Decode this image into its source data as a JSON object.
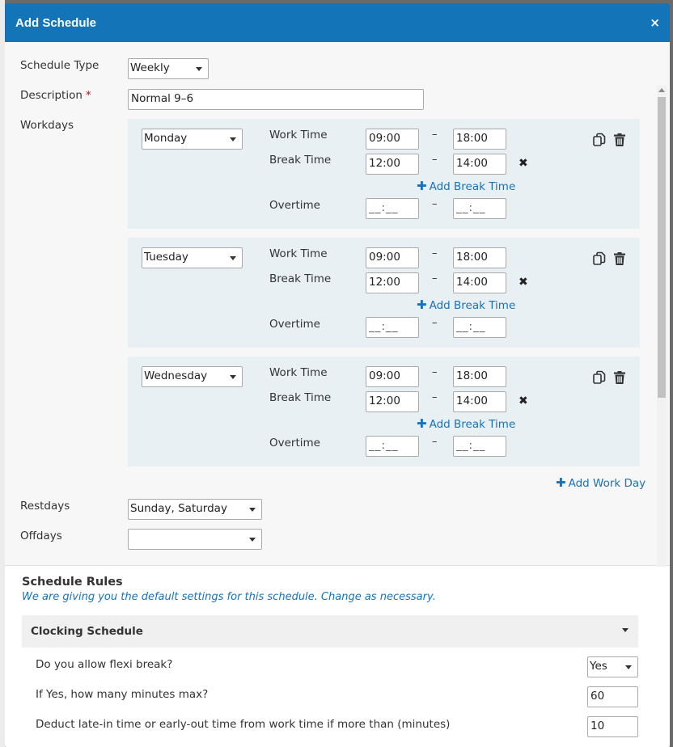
{
  "modal": {
    "title": "Add Schedule",
    "close": "×"
  },
  "form": {
    "schedule_type": {
      "label": "Schedule Type",
      "value": "Weekly"
    },
    "description": {
      "label": "Description",
      "required_mark": "*",
      "value": "Normal 9–6"
    },
    "workdays_label": "Workdays",
    "work_time_label": "Work Time",
    "break_time_label": "Break Time",
    "overtime_label": "Overtime",
    "dash": "–",
    "remove_mark": "✖",
    "add_break_label": "Add Break Time",
    "add_plus": "✚",
    "empty_time": "__:__",
    "days": [
      {
        "day": "Monday",
        "work_start": "09:00",
        "work_end": "18:00",
        "break_start": "12:00",
        "break_end": "14:00"
      },
      {
        "day": "Tuesday",
        "work_start": "09:00",
        "work_end": "18:00",
        "break_start": "12:00",
        "break_end": "14:00"
      },
      {
        "day": "Wednesday",
        "work_start": "09:00",
        "work_end": "18:00",
        "break_start": "12:00",
        "break_end": "14:00"
      }
    ],
    "add_work_day_label": "Add Work Day",
    "restdays": {
      "label": "Restdays",
      "value": "Sunday, Saturday"
    },
    "offdays": {
      "label": "Offdays",
      "value": ""
    }
  },
  "rules": {
    "title": "Schedule Rules",
    "subtitle": "We are giving you the default settings for this schedule. Change as necessary.",
    "section_title": "Clocking Schedule",
    "items": [
      {
        "label": "Do you allow flexi break?",
        "value": "Yes"
      },
      {
        "label": "If Yes, how many minutes max?",
        "value": "60"
      },
      {
        "label": "Deduct late-in time or early-out time from work time if more than (minutes)",
        "value": "10"
      }
    ]
  },
  "colors": {
    "header": "#1474b8",
    "link": "#1a72b5",
    "day_block": "#e8f0f4",
    "required": "#d0021b"
  },
  "icons": {
    "copy": "copy-icon",
    "delete": "trash-icon",
    "remove": "close-icon",
    "add": "plus-icon"
  }
}
